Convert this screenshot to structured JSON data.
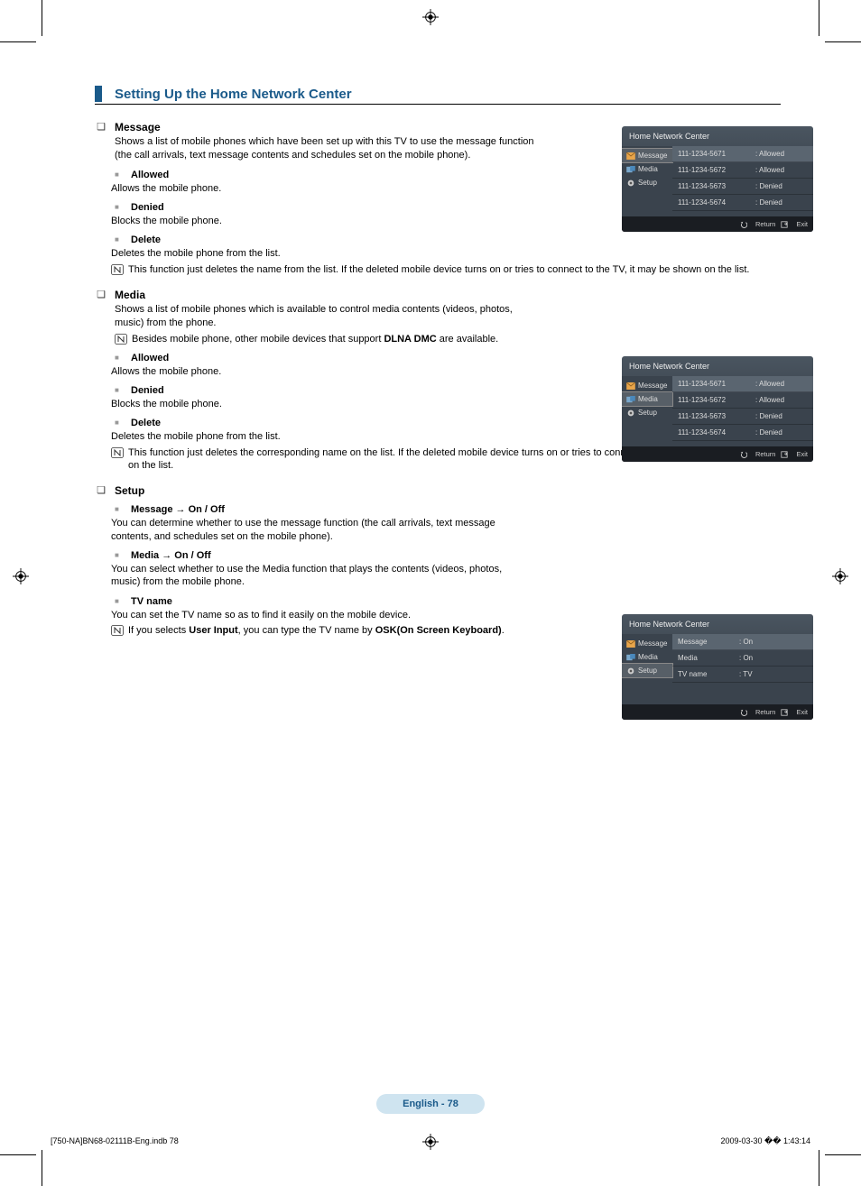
{
  "section_title": "Setting Up the Home Network Center",
  "message": {
    "heading": "Message",
    "desc": "Shows a list of mobile phones which have been set up with this TV to use the message function (the call arrivals, text message contents and schedules set on the mobile phone).",
    "allowed": {
      "heading": "Allowed",
      "desc": "Allows the mobile phone."
    },
    "denied": {
      "heading": "Denied",
      "desc": "Blocks the mobile phone."
    },
    "delete": {
      "heading": "Delete",
      "desc": "Deletes the mobile phone from the list.",
      "note": "This function just deletes the name from the list. If the deleted mobile device turns on or tries to connect to the TV, it may be shown on the list."
    }
  },
  "media": {
    "heading": "Media",
    "desc": "Shows a list of mobile phones which is available to control media contents (videos, photos, music) from the phone.",
    "note_prefix": "Besides mobile phone, other mobile devices that support ",
    "note_bold": "DLNA DMC",
    "note_suffix": " are available.",
    "allowed": {
      "heading": "Allowed",
      "desc": "Allows the mobile phone."
    },
    "denied": {
      "heading": "Denied",
      "desc": "Blocks the mobile phone."
    },
    "delete": {
      "heading": "Delete",
      "desc": "Deletes the mobile phone from the list.",
      "note": "This function just deletes the corresponding name on the list. If the deleted mobile device turns on or tries to connect to the TV, it may be shown on the list."
    }
  },
  "setup": {
    "heading": "Setup",
    "msg": {
      "heading": "Message → On / Off",
      "desc": "You can determine whether to use the message function (the call arrivals, text message contents, and schedules set on the mobile phone)."
    },
    "med": {
      "heading": "Media → On / Off",
      "desc": "You can select whether to use the Media function that plays the contents (videos, photos, music) from the mobile phone."
    },
    "tvname": {
      "heading": "TV name",
      "desc": "You can set the TV name so as to find it easily on the mobile device.",
      "note_prefix": "If you selects ",
      "note_bold1": "User Input",
      "note_mid": ", you can type the TV name by ",
      "note_bold2": "OSK(On Screen Keyboard)",
      "note_suffix": "."
    }
  },
  "screens": {
    "title": "Home Network Center",
    "side": {
      "message": "Message",
      "media": "Media",
      "setup": "Setup"
    },
    "phones": [
      {
        "num": "111-1234-5671",
        "status": ": Allowed"
      },
      {
        "num": "111-1234-5672",
        "status": ": Allowed"
      },
      {
        "num": "111-1234-5673",
        "status": ": Denied"
      },
      {
        "num": "111-1234-5674",
        "status": ": Denied"
      }
    ],
    "setup_rows": [
      {
        "k": "Message",
        "v": ": On"
      },
      {
        "k": "Media",
        "v": ": On"
      },
      {
        "k": "TV name",
        "v": ": TV"
      }
    ],
    "footer": {
      "return": "Return",
      "exit": "Exit"
    }
  },
  "page_footer": "English - 78",
  "bottom_left": "[750-NA]BN68-02111B-Eng.indb   78",
  "bottom_right": "2009-03-30   �� 1:43:14"
}
